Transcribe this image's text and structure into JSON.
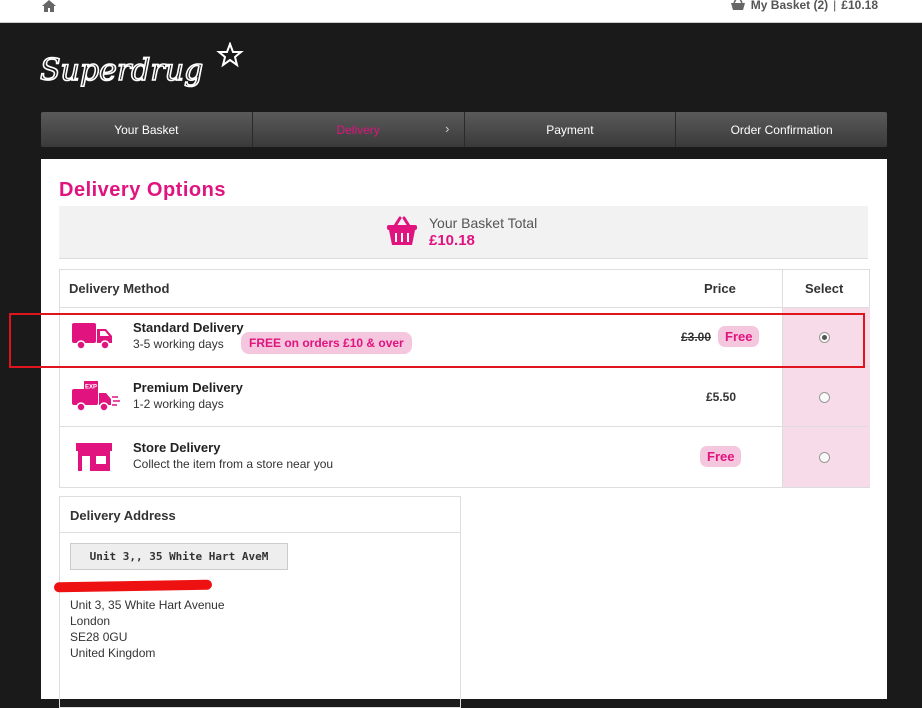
{
  "topbar": {
    "home_icon": "home-icon",
    "basket_icon": "basket-icon",
    "basket_label": "My Basket (2)",
    "separator": "|",
    "basket_total": "£10.18"
  },
  "brand": {
    "logo_text": "Superdrug",
    "accent": "#e0137f"
  },
  "steps": [
    {
      "label": "Your Basket"
    },
    {
      "label": "Delivery",
      "chevron": "›"
    },
    {
      "label": "Payment"
    },
    {
      "label": "Order Confirmation"
    }
  ],
  "page_title": "Delivery Options",
  "basket_total": {
    "label": "Your Basket Total",
    "value": "£10.18"
  },
  "table": {
    "headers": {
      "method": "Delivery Method",
      "price": "Price",
      "select": "Select"
    },
    "rows": [
      {
        "name": "Standard Delivery",
        "sub": "3-5 working days",
        "promo": "FREE on orders £10 & over",
        "old_price": "£3.00",
        "price_badge": "Free",
        "selected": true,
        "icon": "delivery-van-icon"
      },
      {
        "name": "Premium Delivery",
        "sub": "1-2 working days",
        "price": "£5.50",
        "selected": false,
        "icon": "express-van-icon"
      },
      {
        "name": "Store Delivery",
        "sub": "Collect the item from a store near you",
        "price_badge": "Free",
        "selected": false,
        "icon": "store-icon"
      }
    ]
  },
  "address": {
    "title": "Delivery Address",
    "selector_value": "Unit 3,, 35 White Hart AveM",
    "lines": [
      "Unit 3, 35 White Hart Avenue",
      "London",
      "SE28 0GU",
      "United Kingdom"
    ]
  }
}
